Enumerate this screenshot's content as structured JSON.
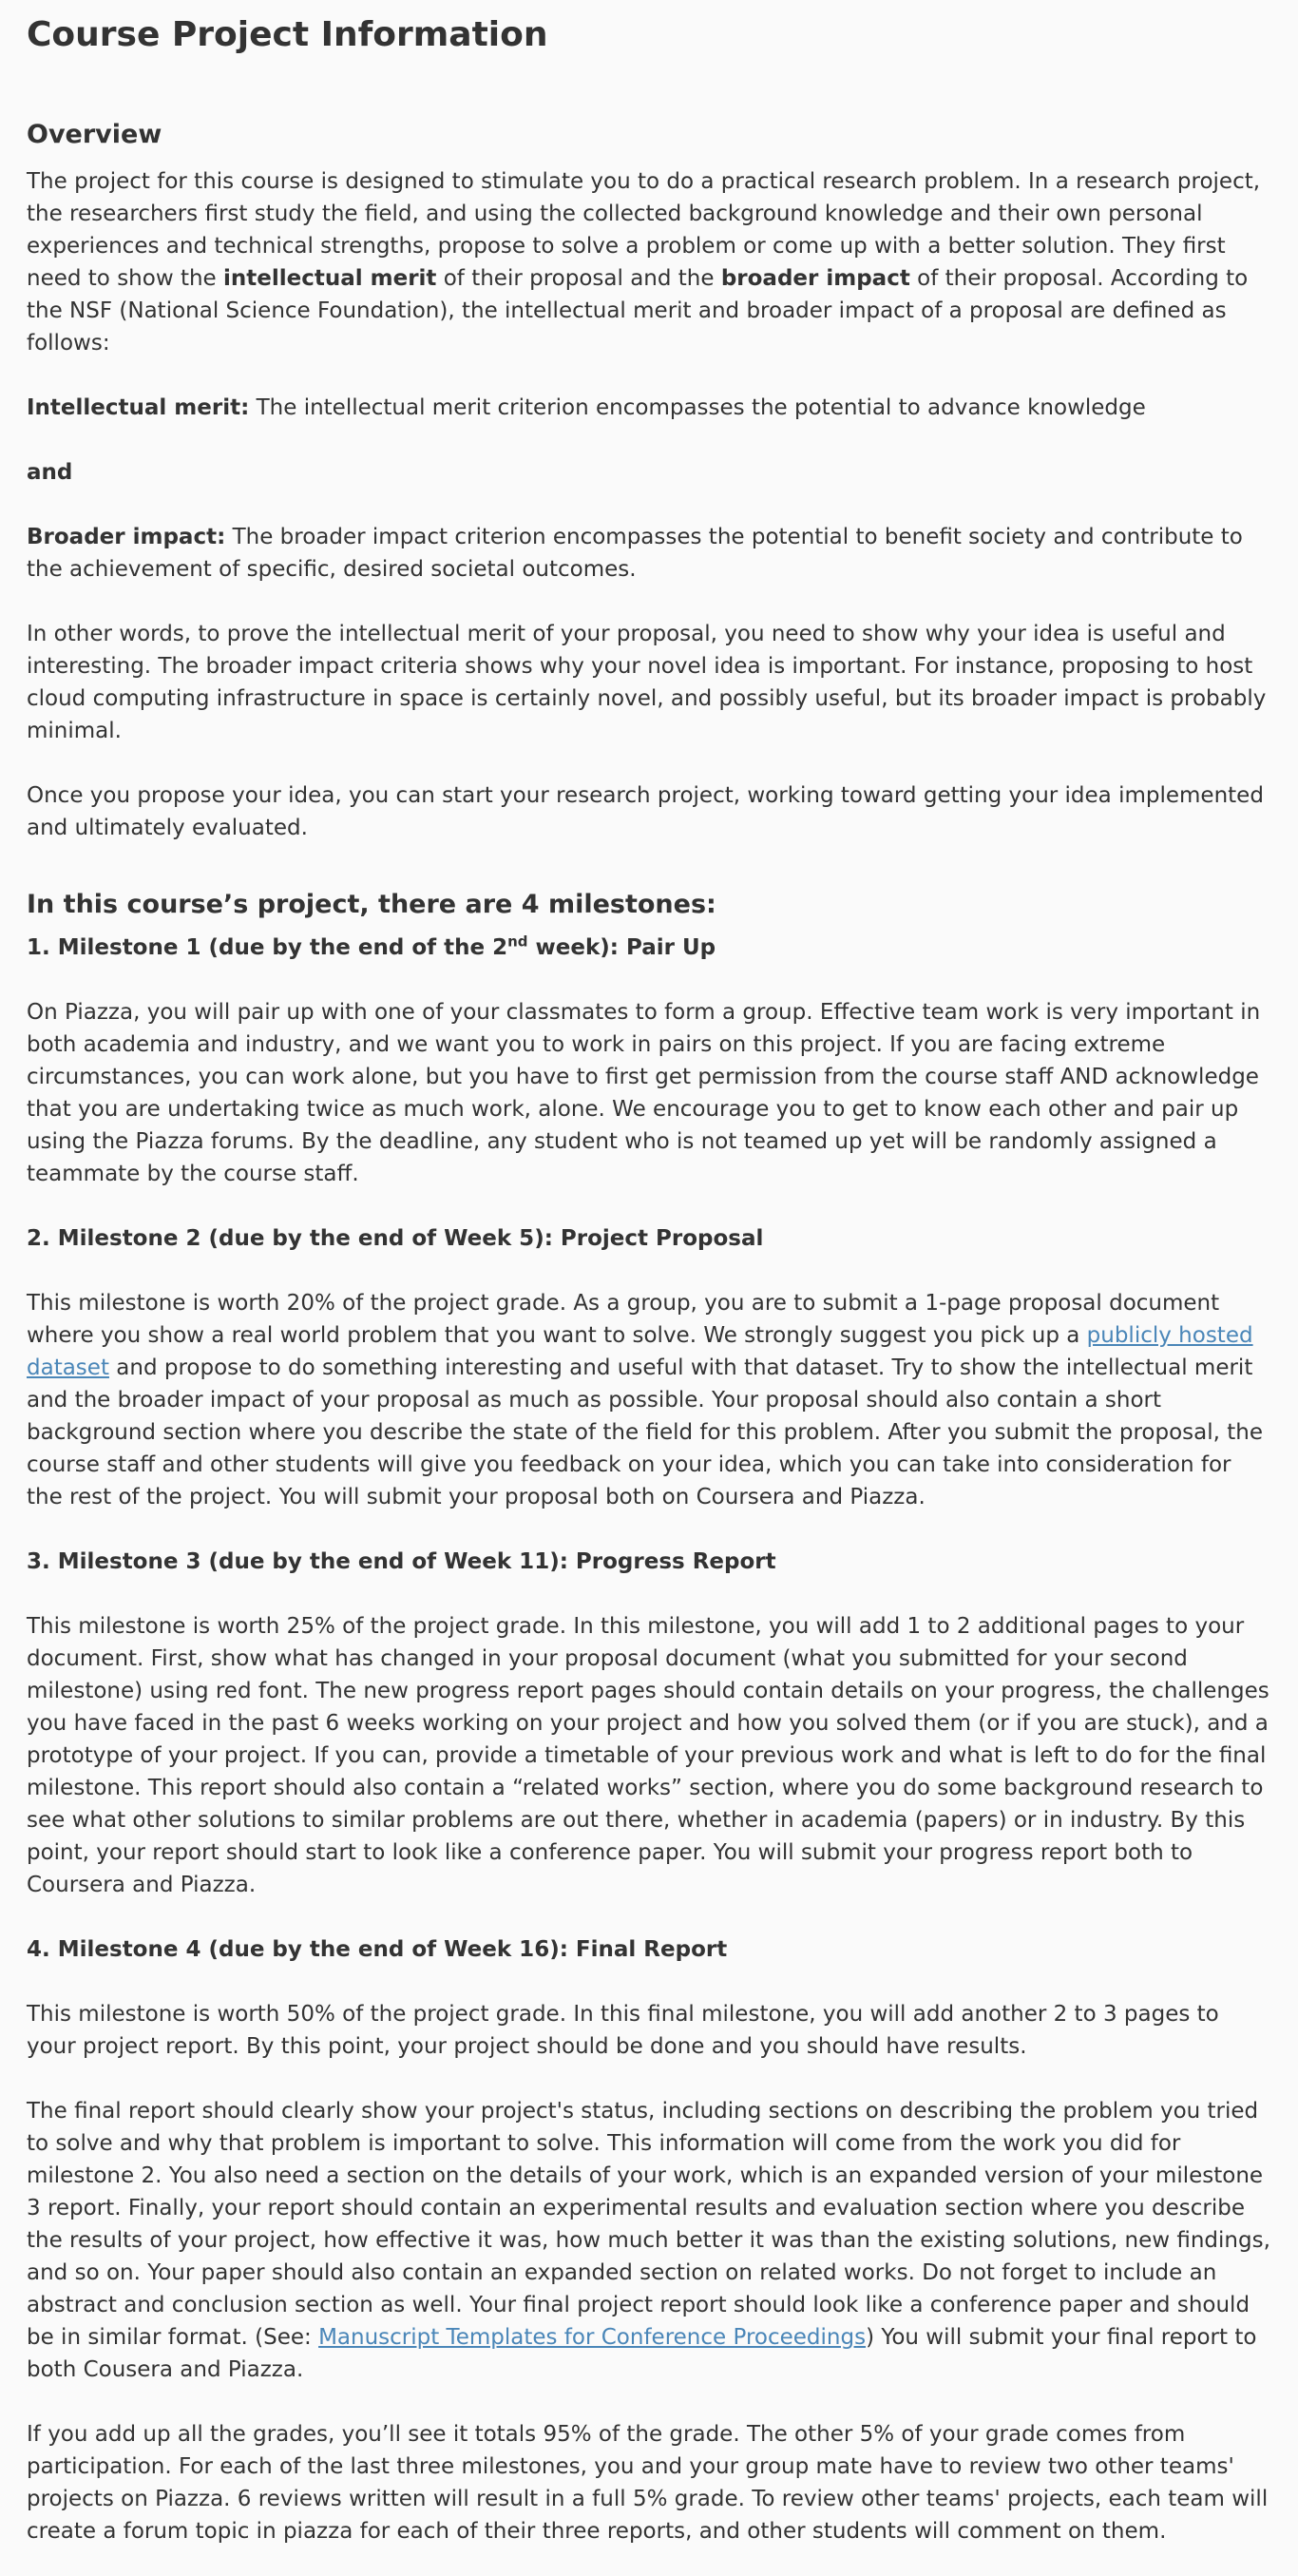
{
  "title": "Course Project Information",
  "overview": {
    "heading": "Overview",
    "intro": {
      "t1": "The project for this course is designed to stimulate you to do a practical research problem. In a research project, the researchers first study the field, and using the collected background knowledge and their own personal experiences and technical strengths, propose to solve a problem or come up with a better solution. They first need to show the ",
      "b1": "intellectual merit",
      "t2": " of their proposal and the ",
      "b2": "broader impact",
      "t3": " of their proposal. According to the NSF (National Science Foundation), the intellectual merit and broader impact of a proposal are defined as follows:"
    },
    "merit": {
      "label": "Intellectual merit:",
      "text": " The intellectual merit criterion encompasses the potential to advance knowledge"
    },
    "and": "and",
    "impact": {
      "label": "Broader impact:",
      "text": " The broader impact criterion encompasses the potential to benefit society and contribute to the achievement of specific, desired societal outcomes."
    },
    "p_other_words": "In other words, to prove the intellectual merit of your proposal, you need to show why your idea is useful and interesting. The broader impact criteria shows why your novel idea is important. For instance, proposing to host cloud computing infrastructure in space is certainly novel, and possibly useful, but its broader impact is probably minimal.",
    "p_once": "Once you propose your idea, you can start your research project, working toward getting your idea implemented and ultimately evaluated."
  },
  "milestones": {
    "heading": "In this course’s project, there are 4 milestones:",
    "m1": {
      "head_a": "1. Milestone 1 (due by the end of the 2",
      "head_sup": "nd",
      "head_b": " week): Pair Up",
      "body": "On Piazza, you will pair up with one of your classmates to form a group. Effective team work is very important in both academia and industry, and we want you to work in pairs on this project. If you are facing extreme circumstances, you can work alone, but you have to first get permission from the course staff AND acknowledge that you are undertaking twice as much work, alone. We encourage you to get to know each other and pair up using the Piazza forums. By the deadline, any student who is not teamed up yet will be randomly assigned a teammate by the course staff."
    },
    "m2": {
      "head": "2. Milestone 2 (due by the end of Week 5): Project Proposal",
      "body_a": "This milestone is worth 20% of the project grade. As a group, you are to submit a 1-page proposal document where you show a real world problem that you want to solve. We strongly suggest you pick up a ",
      "link": "publicly hosted dataset",
      "body_b": " and propose to do something interesting and useful with that dataset. Try to show the intellectual merit and the broader impact of your proposal as much as possible. Your proposal should also contain a short background section where you describe the state of the field for this problem. After you submit the proposal, the course staff and other students will give you feedback on your idea, which you can take into consideration for the rest of the project. You will submit your proposal both on Coursera and Piazza."
    },
    "m3": {
      "head": "3. Milestone 3 (due by the end of Week 11): Progress Report",
      "body": "This milestone is worth 25% of the project grade. In this milestone, you will add 1 to 2 additional pages to your document. First, show what has changed in your proposal document (what you submitted for your second milestone) using red font. The new progress report pages should contain details on your progress, the challenges you have faced in the past 6 weeks working on your project and how you solved them (or if you are stuck), and a prototype of your project. If you can, provide a timetable of your previous work and what is left to do for the final milestone. This report should also contain a “related works” section, where you do some background research to see what other solutions to similar problems are out there, whether in academia (papers) or in industry. By this point, your report should start to look like a conference paper. You will submit your progress report both to Coursera and Piazza."
    },
    "m4": {
      "head": "4. Milestone 4 (due by the end of Week 16): Final Report",
      "body1": "This milestone is worth 50% of the project grade. In this final milestone, you will add another 2 to 3 pages to your project report. By this point, your project should be done and you should have results.",
      "body2_a": "The final report should clearly show your project's status, including sections on describing the problem you tried to solve and why that problem is important to solve. This information will come from the work you did for milestone 2. You also need a section on the details of your work, which is an expanded version of your milestone 3 report. Finally, your report should contain an experimental results and evaluation section where you describe the results of your project, how effective it was, how much better it was than the existing solutions, new findings, and so on. Your paper should also contain an expanded section on related works. Do not forget to include an abstract and conclusion section as well. Your final project report should look like a conference paper and should be in similar format. (See: ",
      "link": "Manuscript Templates for Conference Proceedings",
      "body2_b": ") You will submit your final report to both Cousera and Piazza."
    },
    "closing": "If you add up all the grades, you’ll see it totals 95% of the grade. The other 5% of your grade comes from participation. For each of the last three milestones, you and your group mate have to review two other teams' projects on Piazza. 6 reviews written will result in a full 5% grade. To review other teams' projects, each team will create a forum topic in piazza for each of their three reports, and other students will comment on them."
  }
}
